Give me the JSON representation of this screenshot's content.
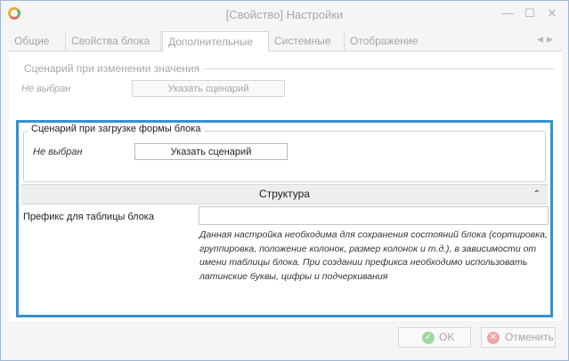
{
  "window": {
    "title": "[Свойство] Настройки"
  },
  "tabs": [
    {
      "label": "Общие"
    },
    {
      "label": "Свойства блока"
    },
    {
      "label": "Дополнительные"
    },
    {
      "label": "Системные"
    },
    {
      "label": "Отображение"
    }
  ],
  "group_change": {
    "legend": "Сценарий при изменении значения",
    "status": "Не выбран",
    "button": "Указать сценарий"
  },
  "group_load": {
    "legend": "Сценарий при загрузке формы блока",
    "status": "Не выбран",
    "button": "Указать сценарий"
  },
  "structure": {
    "heading": "Структура",
    "prefix_label": "Префикс для таблицы блока",
    "prefix_value": "",
    "prefix_help": "Данная настройка необходима для сохранения состояний блока (сортировка, группировка, положение колонок, размер колонок и т.д.), в зависимости от имени таблицы блока. При создании префикса необходимо использовать латинские буквы, цифры и подчеркивания"
  },
  "footer": {
    "ok_label": "OK",
    "cancel_label": "Отменить"
  },
  "colors": {
    "highlight": "#3a8fcc",
    "ok": "#9fd89f",
    "cancel": "#f1a6a6"
  }
}
